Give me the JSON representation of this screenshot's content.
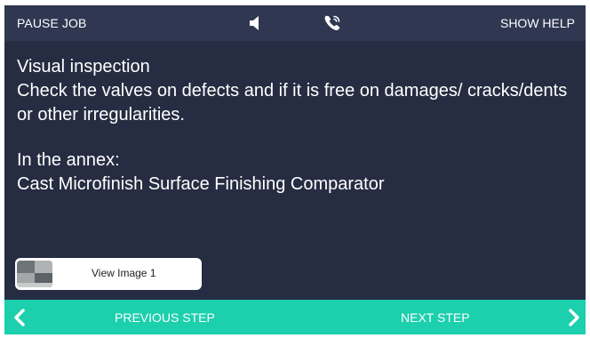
{
  "topbar": {
    "pause_label": "PAUSE JOB",
    "help_label": "SHOW HELP",
    "speaker_icon": "speaker-icon",
    "phone_icon": "phone-icon"
  },
  "step": {
    "title": "Visual inspection",
    "instructions": "Check the valves on defects and  if it is free on damages/ cracks/dents or other irregularities.",
    "annex_label": "In the annex:",
    "annex_item": "Cast Microfinish Surface Finishing Comparator"
  },
  "attachment": {
    "label": "View Image 1"
  },
  "navigation": {
    "previous_label": "PREVIOUS STEP",
    "next_label": "NEXT STEP",
    "previous_icon": "chevron-left-icon",
    "next_icon": "chevron-right-icon"
  },
  "colors": {
    "background": "#262d42",
    "topbar": "#2f3751",
    "bottombar": "#1ccfad",
    "text": "#ffffff"
  }
}
